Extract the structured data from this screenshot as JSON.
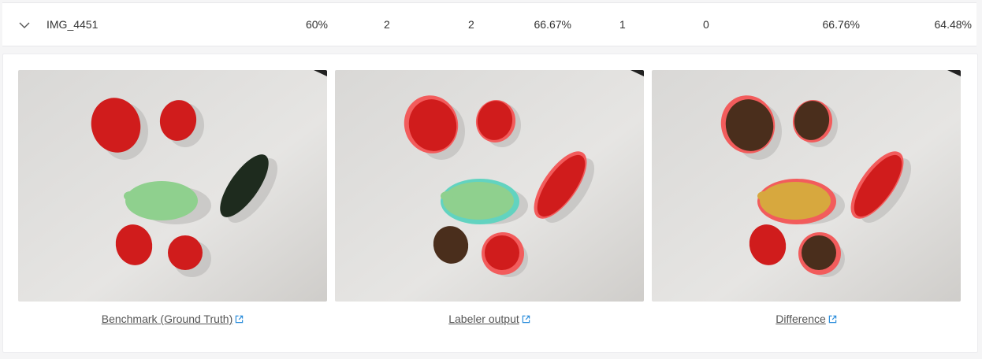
{
  "row": {
    "name": "IMG_4451",
    "values": [
      "60%",
      "2",
      "2",
      "66.67%",
      "1",
      "0",
      "66.76%",
      "64.48%"
    ]
  },
  "panels": [
    {
      "caption": "Benchmark (Ground Truth)"
    },
    {
      "caption": "Labeler output"
    },
    {
      "caption": "Difference"
    }
  ],
  "colors": {
    "label_red": "#d01c1c",
    "label_green": "#8fd08e",
    "label_dark_green": "#1e2b1e",
    "mismatch_outline": "#f25c5c",
    "kiwi_brown": "#4a2e1c",
    "lemon_yellow": "#d7a83e",
    "link_icon": "#2b8ddb"
  }
}
